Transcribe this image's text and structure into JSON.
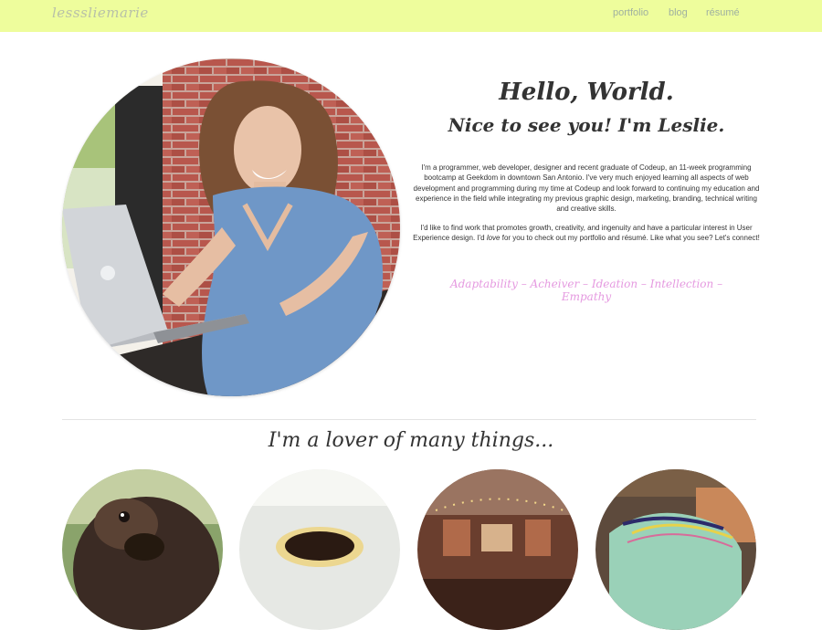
{
  "nav": {
    "logo": "lesssliemarie",
    "links": [
      "portfolio",
      "blog",
      "résumé"
    ]
  },
  "hero": {
    "greeting": "Hello, World.",
    "intro": "Nice to see you! I'm Leslie.",
    "paragraph1": "I'm a programmer, web developer, designer and recent graduate of Codeup, an 11-week programming bootcamp at Geekdom in downtown San Antonio. I've very much enjoyed learning all aspects of web development and programming during my time at Codeup and look forward to continuing my education and experience in the field while integrating my previous graphic design, marketing, branding, technical writing and creative skills.",
    "paragraph2_before": "I'd like to find work that promotes growth, creativity, and ingenuity and have a particular interest in User Experience design. I'd ",
    "paragraph2_emphasis": "love",
    "paragraph2_after": " for you to check out my portfolio and résumé. Like what you see? Let's connect!",
    "strengths": "Adaptability – Acheiver – Ideation – Intellection – Empathy"
  },
  "section": {
    "heading": "I'm a lover of many things..."
  },
  "colors": {
    "navbar": "#eefd9c",
    "strengths": "#e59ae0"
  }
}
